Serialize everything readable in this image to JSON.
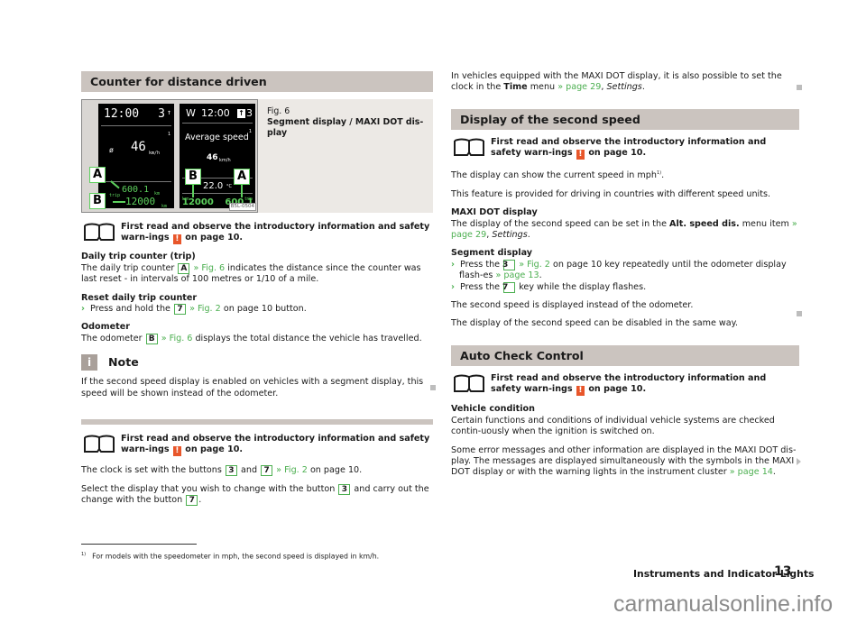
{
  "left": {
    "section1": {
      "title": "Counter for distance driven",
      "figure": {
        "label": "Fig. 6",
        "caption": "Segment display / MAXI DOT dis-play",
        "image_code": "B5L-0504",
        "segment_display": {
          "time": "12:00",
          "gear": "3",
          "index": "1",
          "avg_symbol": "ø",
          "speed": "46",
          "speed_unit": "km/h",
          "trip_label": "trip",
          "trip_value": "600.1",
          "trip_unit": "km",
          "odo_value": "12000",
          "odo_unit": "km",
          "callout_a": "A",
          "callout_b": "B"
        },
        "maxidot_display": {
          "day": "W",
          "time": "12:00",
          "gear": "3",
          "index": "1",
          "title": "Average speed",
          "speed": "46",
          "speed_unit": "km/h",
          "temp": "22.0",
          "temp_unit": "°C",
          "odo_label": "km",
          "odo_value": "12000",
          "trip_label": "trip",
          "trip_value": "600.1",
          "callout_a": "A",
          "callout_b": "B"
        }
      },
      "warning": {
        "text_before": "First read and observe the introductory information and safety warn-ings",
        "text_after": "on page 10.",
        "mark": "!"
      },
      "daily_trip": {
        "heading": "Daily trip counter (trip)",
        "t1": "The daily trip counter",
        "key": "A",
        "link": "» Fig. 6",
        "t2": "indicates the distance since the counter was last reset - in intervals of 100 metres or 1/10 of a mile."
      },
      "reset": {
        "heading": "Reset daily trip counter",
        "bullet": "›",
        "t1": "Press and hold the",
        "key": "7",
        "link": "» Fig. 2",
        "t2": "on page 10 button."
      },
      "odometer": {
        "heading": "Odometer",
        "t1": "The odometer",
        "key": "B",
        "link": "» Fig. 6",
        "t2": "displays the total distance the vehicle has travelled."
      },
      "note": {
        "icon": "i",
        "title": "Note",
        "text": "If the second speed display is enabled on vehicles with a segment display, this speed will be shown instead of the odometer."
      }
    },
    "section2": {
      "warning": {
        "text_before": "First read and observe the introductory information and safety warn-ings",
        "text_after": "on page 10.",
        "mark": "!"
      },
      "p1": {
        "t1": "The clock is set with the buttons",
        "key1": "3",
        "and": "and",
        "key2": "7",
        "link": "» Fig. 2",
        "t2": "on page 10."
      },
      "p2": {
        "t1": "Select the display that you wish to change with the button",
        "key1": "3",
        "t2": "and carry out the change with the button",
        "key2": "7",
        "t3": "."
      }
    }
  },
  "right": {
    "intro": {
      "t1": "In vehicles equipped with the MAXI DOT display, it is also possible to set the clock in the",
      "bold": "Time",
      "t2": "menu",
      "link": "» page 29",
      "t3": ",",
      "italic": "Settings",
      "t4": "."
    },
    "second_speed": {
      "title": "Display of the second speed",
      "warning": {
        "text_before": "First read and observe the introductory information and safety warn-ings",
        "text_after": "on page 10.",
        "mark": "!"
      },
      "p1": "The display can show the current speed in mph",
      "p1_sup": "1)",
      "p1_end": ".",
      "p2": "This feature is provided for driving in countries with different speed units.",
      "maxi": {
        "heading": "MAXI DOT display",
        "t1": "The display of the second speed can be set in the",
        "bold": "Alt. speed dis.",
        "t2": "menu item",
        "link": "» page 29",
        "t3": ",",
        "italic": "Settings",
        "t4": "."
      },
      "segment": {
        "heading": "Segment display",
        "b1_t1": "Press the",
        "b1_key": "3",
        "b1_link": "» Fig. 2",
        "b1_t2": "on page 10 key repeatedly until the odometer display flash-es",
        "b1_link2": "» page 13",
        "b1_t3": ".",
        "b2_t1": "Press the",
        "b2_key": "7",
        "b2_t2": "key while the display flashes.",
        "bullet": "›"
      },
      "p3": "The second speed is displayed instead of the odometer.",
      "p4": "The display of the second speed can be disabled in the same way."
    },
    "auto_check": {
      "title": "Auto Check Control",
      "warning": {
        "text_before": "First read and observe the introductory information and safety warn-ings",
        "text_after": "on page 10.",
        "mark": "!"
      },
      "vehicle": {
        "heading": "Vehicle condition",
        "text": "Certain functions and conditions of individual vehicle systems are checked contin-uously when the ignition is switched on."
      },
      "p2": {
        "t1": "Some error messages and other information are displayed in the MAXI DOT dis-play. The messages are displayed simultaneously with the symbols in the MAXI DOT display or with the warning lights in the instrument cluster",
        "link": "» page 14",
        "t2": "."
      }
    }
  },
  "footnote": {
    "mark": "1)",
    "text": "For models with the speedometer in mph, the second speed is displayed in km/h."
  },
  "footer": {
    "chapter": "Instruments and Indicator Lights",
    "page": "13"
  },
  "watermark": "carmanualsonline.info"
}
